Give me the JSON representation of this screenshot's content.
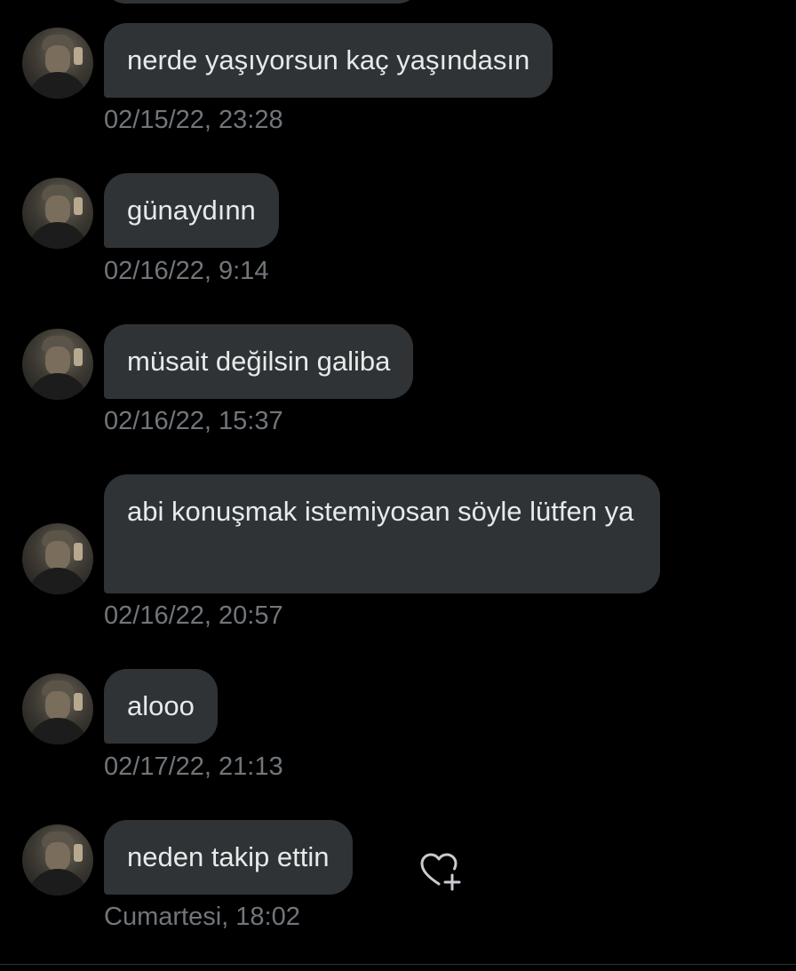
{
  "conversation": {
    "avatar_icon": "profile-avatar-icon",
    "messages": [
      {
        "text": "nerde yaşıyorsun kaç yaşındasın",
        "timestamp": "02/15/22, 23:28"
      },
      {
        "text": "günaydınn",
        "timestamp": "02/16/22, 9:14"
      },
      {
        "text": "müsait değilsin galiba",
        "timestamp": "02/16/22, 15:37"
      },
      {
        "text": "abi konuşmak istemiyosan söyle lütfen ya",
        "timestamp": "02/16/22, 20:57"
      },
      {
        "text": "alooo",
        "timestamp": "02/17/22, 21:13"
      },
      {
        "text": "neden takip ettin",
        "timestamp": "Cumartesi, 18:02"
      }
    ],
    "reaction_icon": "heart-plus-icon"
  },
  "colors": {
    "background": "#000000",
    "bubble": "#2f3336",
    "text": "#e7e9ea",
    "timestamp": "#71767b"
  }
}
